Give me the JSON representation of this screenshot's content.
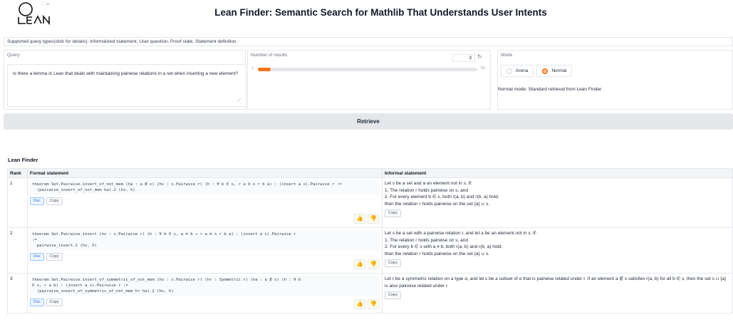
{
  "header": {
    "title": "Lean Finder: Semantic Search for Mathlib That Understands User Intents",
    "logo_text": "LEAN",
    "logo_icons": "⛶ ≪"
  },
  "supported": {
    "text": "Supported query types(click for details): Informalized statement, User question, Proof state, Statement definition"
  },
  "query": {
    "label": "Query",
    "value": "Is there a lemma in Lean that deals with maintaining pairwise relations in a set when inserting a new element?"
  },
  "num_results": {
    "label": "Number of results",
    "value": "3",
    "min": "1",
    "max": "50",
    "fraction": 0.04
  },
  "mode": {
    "label": "Mode",
    "options": [
      {
        "label": "Arena",
        "selected": false
      },
      {
        "label": "Normal",
        "selected": true
      }
    ],
    "description": "Normal mode: Standard retrieval from Lean Finder."
  },
  "retrieve": {
    "label": "Retrieve"
  },
  "results": {
    "title": "Lean Finder",
    "columns": [
      "Rank",
      "Formal statement",
      "Informal statement"
    ],
    "doc_label": "Doc",
    "copy_label": "Copy",
    "rows": [
      {
        "rank": "1",
        "formal": "theorem Set.Pairwise.insert_of_not_mem (ha : a ∉ s) (hs : s.Pairwise r) (h : ∀ b ∈ s, r a b ∧ r b a) : (insert a s).Pairwise r :=\n  (pairwise_insert_of_not_mem ha).2 (hs, h)",
        "informal": [
          "Let s be a set and a an element not in s. If:",
          "1. The relation r holds pairwise on s, and",
          "2. For every element b ∈ s, both r(a, b) and r(b, a) hold,",
          "then the relation r holds pairwise on the set {a} ∪ s."
        ]
      },
      {
        "rank": "2",
        "formal": "theorem Set.Pairwise.insert (hs : s.Pairwise r) (h : ∀ b ∈ s, a ≠ b → r a b ∧ r b a) : (insert a s).Pairwise r\n:=\n  pairwise_insert.2 (hs, h)",
        "informal": [
          "Let s be a set with a pairwise relation r, and let a be an element not in s. If:",
          "1. The relation r holds pairwise on s, and",
          "2. For every b ∈ s with a ≠ b, both r(a, b) and r(b, a) hold,",
          "then the relation r holds pairwise on the set {a} ∪ s."
        ]
      },
      {
        "rank": "3",
        "formal": "theorem Set.Pairwise.insert_of_symmetric_of_not_mem (hs : s.Pairwise r) (hr : Symmetric r) (ha : a ∉ s) (h : ∀ b\n∈ s, r a b) : (insert a s).Pairwise r :=\n  (pairwise_insert_of_symmetric_of_not_mem hr ha).2 (hs, h)",
        "informal": [
          "Let r be a symmetric relation on a type α, and let s be a subset of α that is pairwise related under r. If an element a ∉ s satisfies r(a, b) for all b ∈ s, then the set s ∪ {a} is also pairwise related under r."
        ]
      }
    ]
  },
  "colors": {
    "accent": "#f97316",
    "doc": "#2563eb"
  }
}
